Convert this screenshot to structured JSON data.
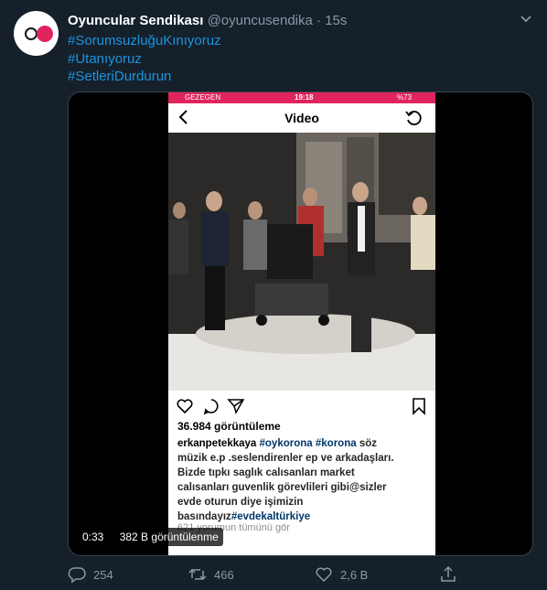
{
  "tweet": {
    "author_name": "Oyuncular Sendikası",
    "handle": "@oyuncusendika",
    "separator": "·",
    "time": "15s",
    "hashtags": [
      "#SorumsuzluğuKınıyoruz",
      "#Utanıyoruz",
      "#SetleriDurdurun"
    ]
  },
  "video": {
    "phone_status": {
      "carrier": "GEZEGEN",
      "time": "19:18",
      "battery": "%73"
    },
    "nav_title": "Video",
    "views_text": "36.984 görüntüleme",
    "caption": {
      "username": "erkanpetekkaya",
      "tag1": "#oykorona",
      "tag2": "#korona",
      "line1_rest": "söz",
      "line2": "müzik e.p .seslendirenler ep ve arkadaşları.",
      "line3": "Bizde tıpkı saglık calısanları market",
      "line4": "calısanları guvenlik görevlileri gibi@sizler",
      "line5": "evde oturun diye işimizin",
      "line6_pre": "basındayız",
      "tag3": "#evdekaltürkiye"
    },
    "comments_text": "621 yorumun tümünü gör",
    "overlay_time": "0:33",
    "overlay_views": "382 B görüntülenme"
  },
  "footer": {
    "replies": "254",
    "retweets": "466",
    "likes": "2,6 B"
  },
  "colors": {
    "background": "#15202b",
    "link": "#1b95e0",
    "muted": "#8899a6",
    "status_bar": "#e0245e"
  }
}
